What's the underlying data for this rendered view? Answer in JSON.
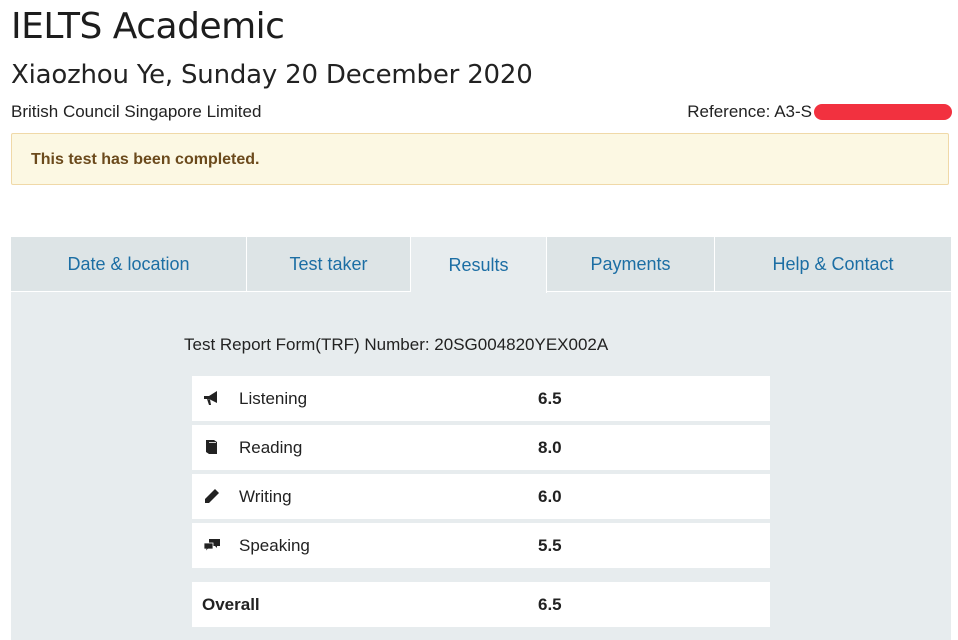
{
  "header": {
    "title": "IELTS Academic",
    "subtitle": "Xiaozhou Ye, Sunday 20 December 2020",
    "organisation": "British Council Singapore Limited",
    "reference_label": "Reference: A3-S",
    "redaction_color": "#f2313f"
  },
  "alert": {
    "message": "This test has been completed."
  },
  "tabs": [
    {
      "label": "Date & location",
      "active": false
    },
    {
      "label": "Test taker",
      "active": false
    },
    {
      "label": "Results",
      "active": true
    },
    {
      "label": "Payments",
      "active": false
    },
    {
      "label": "Help & Contact",
      "active": false
    }
  ],
  "results": {
    "trf_line": "Test Report Form(TRF) Number: 20SG004820YEX002A",
    "skills": [
      {
        "label": "Listening",
        "score": "6.5",
        "icon": "megaphone-icon"
      },
      {
        "label": "Reading",
        "score": "8.0",
        "icon": "book-icon"
      },
      {
        "label": "Writing",
        "score": "6.0",
        "icon": "pencil-icon"
      },
      {
        "label": "Speaking",
        "score": "5.5",
        "icon": "speech-bubbles-icon"
      }
    ],
    "overall": {
      "label": "Overall",
      "score": "6.5"
    }
  },
  "colors": {
    "link": "#1c6ea4",
    "alert_bg": "#fcf8e3",
    "alert_text": "#6b4a1c",
    "panel_bg": "#e7ecee"
  }
}
